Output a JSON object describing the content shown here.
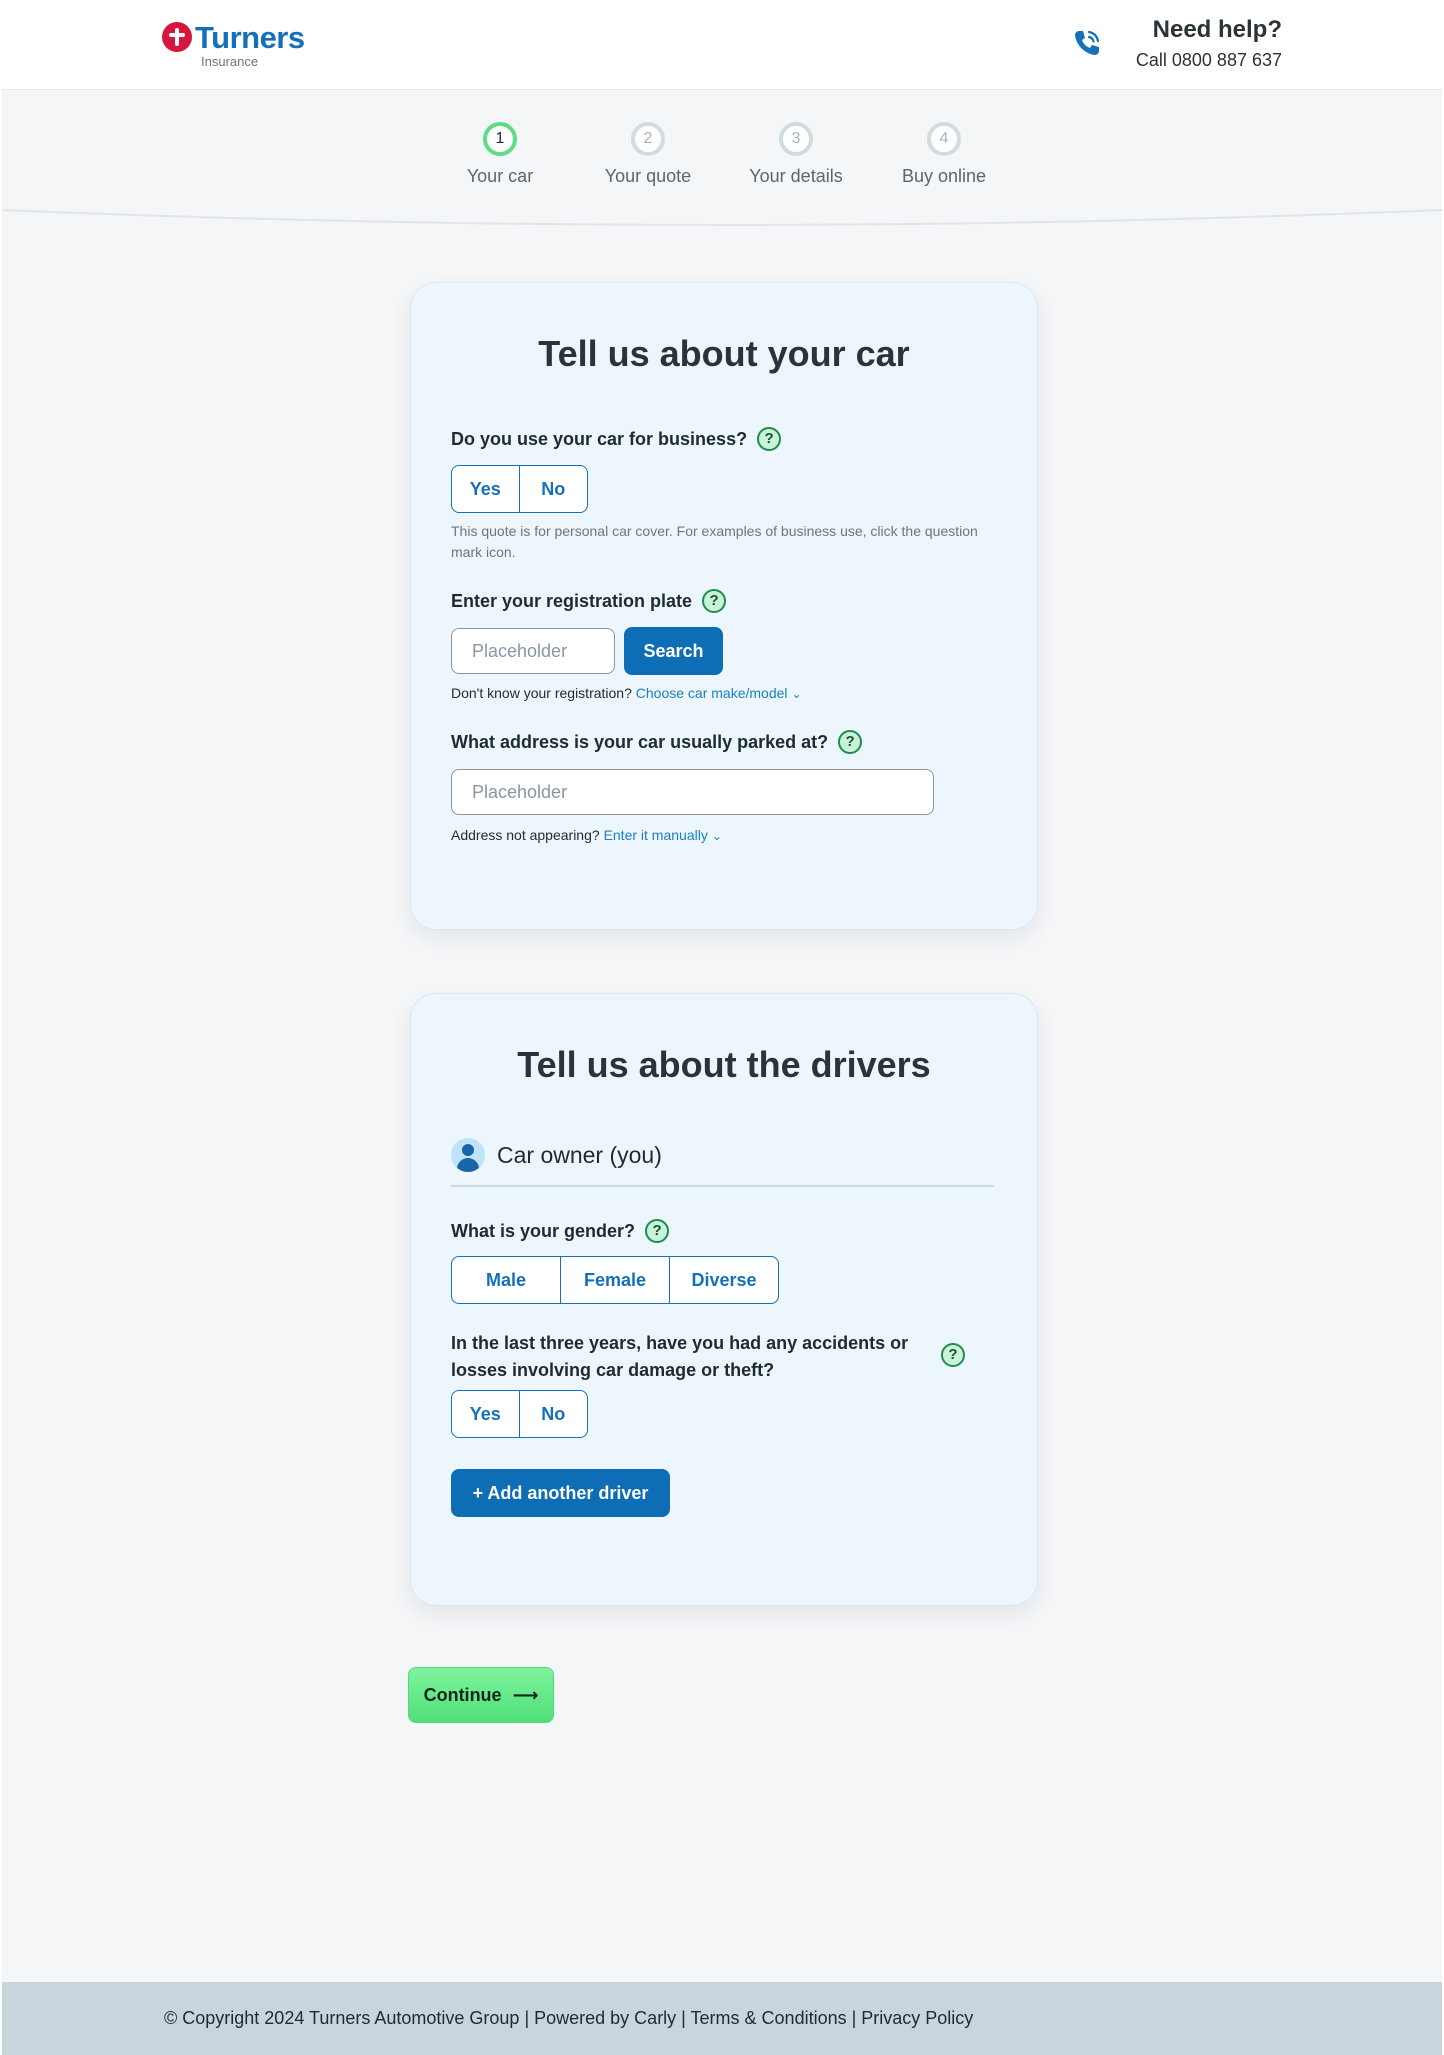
{
  "header": {
    "logo_text": "Turners",
    "logo_sub": "Insurance",
    "help_title": "Need help?",
    "help_phone": "Call 0800 887 637"
  },
  "stepper": {
    "steps": [
      {
        "number": "1",
        "label": "Your car"
      },
      {
        "number": "2",
        "label": "Your quote"
      },
      {
        "number": "3",
        "label": "Your details"
      },
      {
        "number": "4",
        "label": "Buy online"
      }
    ],
    "active_step": 1
  },
  "car_card": {
    "title": "Tell us about your car",
    "business_question": "Do you use your car for business?",
    "business_options": [
      "Yes",
      "No"
    ],
    "business_hint": "This quote is for personal car cover. For examples of business use, click the question mark icon.",
    "rego_question": "Enter your registration plate",
    "rego_placeholder": "Placeholder",
    "search_label": "Search",
    "rego_help_prefix": "Don't know your registration?",
    "rego_help_link": "Choose car make/model",
    "address_question": "What address is your car usually parked at?",
    "address_placeholder": "Placeholder",
    "address_help_prefix": "Address not appearing?",
    "address_help_link": "Enter it manually"
  },
  "drivers_card": {
    "title": "Tell us about the drivers",
    "owner_label": "Car owner (you)",
    "gender_question": "What is your gender?",
    "gender_options": [
      "Male",
      "Female",
      "Diverse"
    ],
    "accidents_question": "In the last three years, have you had any accidents or losses  involving car damage or theft?",
    "accident_options": [
      "Yes",
      "No"
    ],
    "add_driver_label": "+ Add another driver"
  },
  "continue_label": "Continue",
  "footer": {
    "text": "© Copyright 2024 Turners Automotive Group  | Powered by Carly | Terms & Conditions | Privacy Policy"
  },
  "colors": {
    "brand_blue": "#1470b8",
    "brand_red": "#d6163f",
    "accent_green": "#4fdf78"
  }
}
